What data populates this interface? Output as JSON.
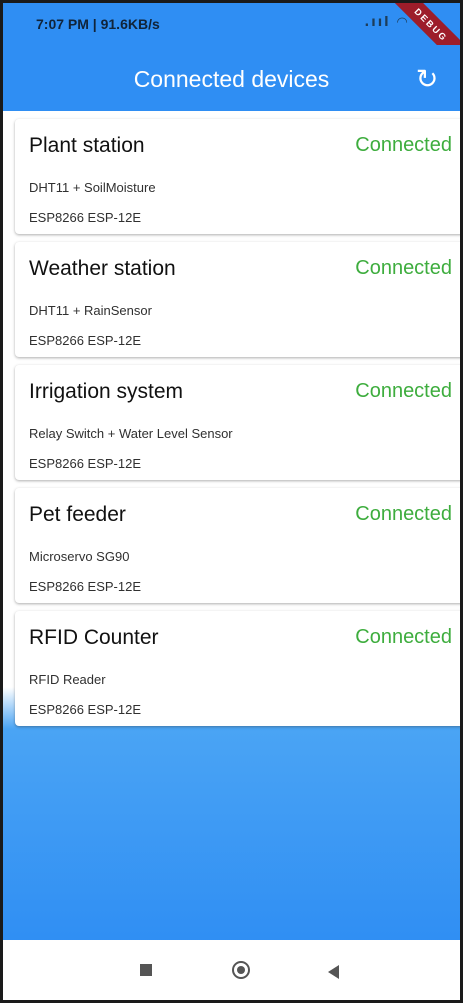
{
  "status": {
    "time_rate": "7:07 PM | 91.6KB/s",
    "icons": "signal-icon wifi-icon battery-icon",
    "signal_text": ".ııl",
    "wifi_text": "◠"
  },
  "debug_banner": "DEBUG",
  "appbar": {
    "title": "Connected devices",
    "refresh_icon": "↻"
  },
  "devices": [
    {
      "name": "Plant station",
      "status": "Connected",
      "sensors": "DHT11 + SoilMoisture",
      "board": "ESP8266 ESP-12E"
    },
    {
      "name": "Weather station",
      "status": "Connected",
      "sensors": "DHT11 + RainSensor",
      "board": "ESP8266 ESP-12E"
    },
    {
      "name": "Irrigation system",
      "status": "Connected",
      "sensors": "Relay Switch + Water Level Sensor",
      "board": "ESP8266 ESP-12E"
    },
    {
      "name": "Pet feeder",
      "status": "Connected",
      "sensors": "Microservo SG90",
      "board": "ESP8266 ESP-12E"
    },
    {
      "name": "RFID Counter",
      "status": "Connected",
      "sensors": "RFID Reader",
      "board": "ESP8266 ESP-12E"
    }
  ],
  "colors": {
    "primary": "#2f8ef3",
    "connected": "#3ead3e"
  },
  "nav_icons": [
    "recents-square-icon",
    "home-circle-icon",
    "back-triangle-icon"
  ]
}
